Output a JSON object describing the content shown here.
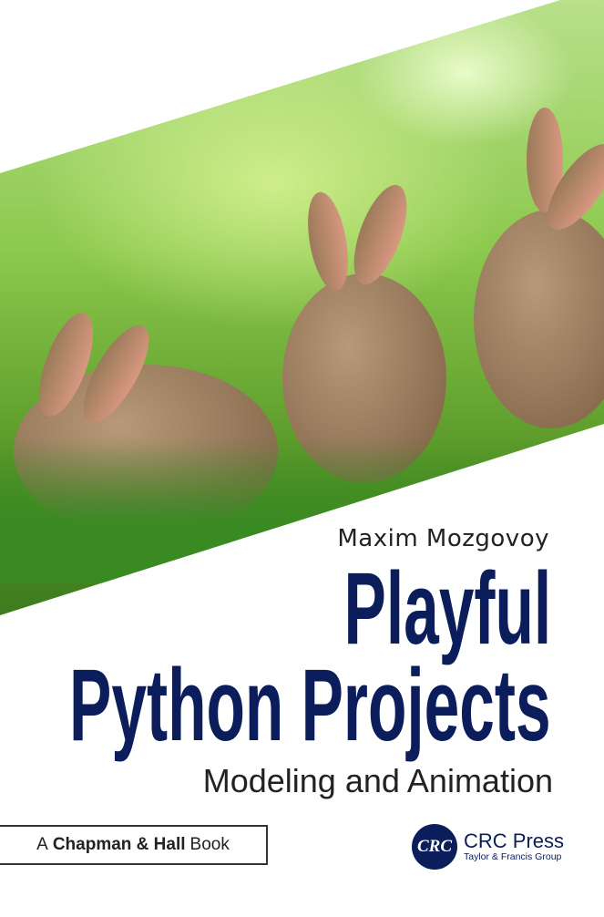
{
  "author": "Maxim Mozgovoy",
  "title_line1": "Playful",
  "title_line2": "Python Projects",
  "subtitle": "Modeling and Animation",
  "series": {
    "prefix": "A",
    "name": "Chapman & Hall",
    "suffix": "Book"
  },
  "publisher": {
    "logo_text": "CRC",
    "name": "CRC Press",
    "group": "Taylor & Francis Group"
  },
  "colors": {
    "title": "#0b1d5a"
  }
}
